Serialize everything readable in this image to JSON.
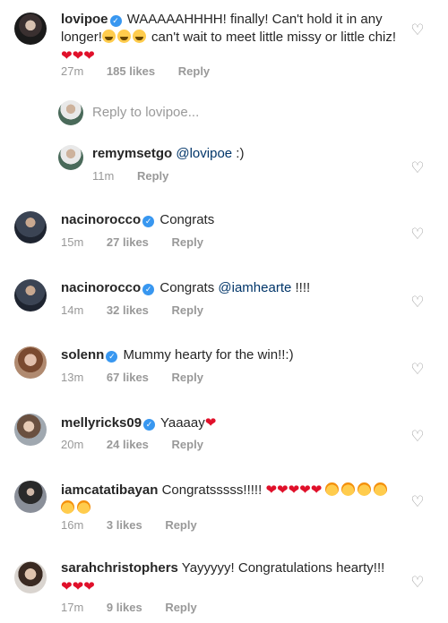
{
  "comments": [
    {
      "username": "lovipoe",
      "verified": true,
      "text": "WAAAAAHHHH! finally! Can't hold it in any longer!",
      "text2": " can't wait to meet little missy or little chiz!",
      "emoji_laugh": "😂😂😂",
      "emoji_hearts": "❤❤❤",
      "time": "27m",
      "likes": "185 likes",
      "reply": "Reply"
    },
    {
      "username": "remymsetgo",
      "mention": "@lovipoe",
      "text": " :)",
      "time": "11m",
      "reply": "Reply"
    },
    {
      "username": "nacinorocco",
      "verified": true,
      "text": "Congrats",
      "time": "15m",
      "likes": "27 likes",
      "reply": "Reply"
    },
    {
      "username": "nacinorocco",
      "verified": true,
      "text": "Congrats ",
      "mention": "@iamhearte",
      "text2": " !!!!",
      "time": "14m",
      "likes": "32 likes",
      "reply": "Reply"
    },
    {
      "username": "solenn",
      "verified": true,
      "text": "Mummy hearty for the win!!:)",
      "time": "13m",
      "likes": "67 likes",
      "reply": "Reply"
    },
    {
      "username": "mellyricks09",
      "verified": true,
      "text": "Yaaaay",
      "emoji_hearts": "❤",
      "time": "20m",
      "likes": "24 likes",
      "reply": "Reply"
    },
    {
      "username": "iamcatatibayan",
      "text": "Congratsssss!!!!!",
      "emoji_hearts": "❤❤❤❤❤",
      "time": "16m",
      "likes": "3 likes",
      "reply": "Reply"
    },
    {
      "username": "sarahchristophers",
      "text": "Yayyyyy! Congratulations hearty!!!",
      "emoji_hearts": "❤❤❤",
      "time": "17m",
      "likes": "9 likes",
      "reply": "Reply"
    }
  ],
  "reply_field": {
    "placeholder": "Reply to lovipoe..."
  },
  "icons": {
    "heart": "heart-outline-icon",
    "verified": "verified-badge-icon",
    "baby": "baby-emoji-icon",
    "laugh": "tears-of-joy-emoji-icon"
  },
  "colors": {
    "text": "#262626",
    "muted": "#999999",
    "mention": "#003569",
    "verified": "#3897f0",
    "red_heart": "#e0102a"
  }
}
